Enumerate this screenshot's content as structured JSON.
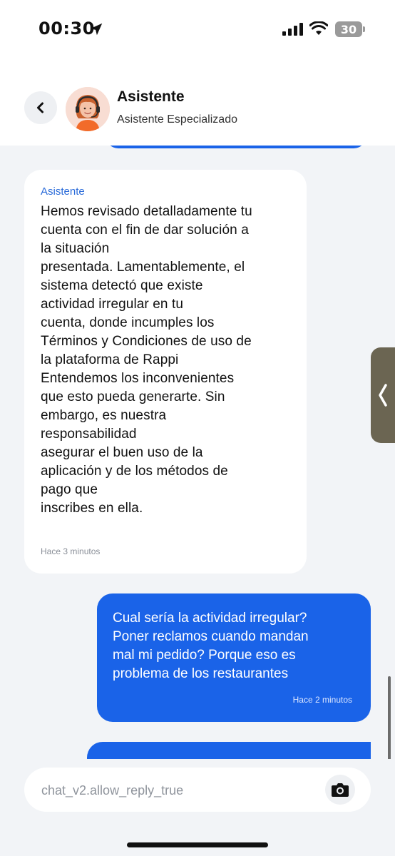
{
  "status_bar": {
    "time": "00:30",
    "battery": "30"
  },
  "header": {
    "title": "Asistente",
    "subtitle": "Asistente Especializado"
  },
  "messages": {
    "bot": {
      "sender": "Asistente",
      "text": "Hemos revisado detalladamente tu\ncuenta con el fin de dar solución a\nla situación\npresentada. Lamentablemente, el\nsistema detectó que existe\nactividad irregular en tu\ncuenta, donde incumples los\nTérminos y Condiciones de uso de\nla plataforma de Rappi\nEntendemos los inconvenientes\nque esto pueda generarte. Sin\nembargo, es nuestra\nresponsabilidad\nasegurar el buen uso de la\naplicación y de los métodos de\npago que\ninscribes en ella.",
      "time": "Hace 3 minutos"
    },
    "user": {
      "text": "Cual sería la actividad irregular?\nPoner reclamos cuando mandan\nmal mi pedido? Porque eso es\nproblema de los restaurantes",
      "time": "Hace 2 minutos"
    }
  },
  "input": {
    "placeholder": "chat_v2.allow_reply_true"
  },
  "colors": {
    "accent": "#1a63e8",
    "background": "#f2f4f7",
    "sender_label": "#2a6bd9"
  },
  "icons": {
    "back": "chevron-left-icon",
    "location": "location-arrow-icon",
    "camera": "camera-icon",
    "side_tab": "chevron-left-icon"
  }
}
